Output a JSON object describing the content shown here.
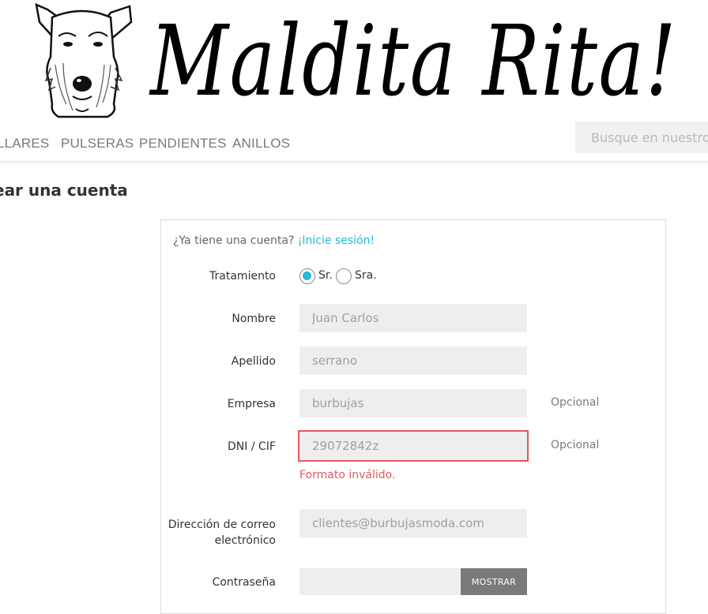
{
  "brand": {
    "name": "Maldita Rita!"
  },
  "nav": {
    "items": [
      "LLARES",
      "PULSERAS",
      "PENDIENTES",
      "ANILLOS"
    ],
    "search_placeholder": "Busque en nuestro"
  },
  "page": {
    "title": "ear una cuenta"
  },
  "form": {
    "login_prompt": "¿Ya tiene una cuenta?",
    "login_link": "¡Inicie sesión!",
    "title_label": "Tratamiento",
    "title_options": [
      {
        "label": "Sr.",
        "checked": true
      },
      {
        "label": "Sra.",
        "checked": false
      }
    ],
    "first_name_label": "Nombre",
    "first_name_value": "Juan Carlos",
    "last_name_label": "Apellido",
    "last_name_value": "serrano",
    "company_label": "Empresa",
    "company_value": "burbujas",
    "company_optional": "Opcional",
    "dni_label": "DNI / CIF",
    "dni_value": "29072842z",
    "dni_optional": "Opcional",
    "dni_error": "Formato inválido.",
    "email_label": "Dirección de correo electrónico",
    "email_value": "clientes@burbujasmoda.com",
    "password_label": "Contraseña",
    "password_value": "",
    "show_button": "MOSTRAR"
  },
  "colors": {
    "accent": "#25b9d7",
    "error": "#e25a5d",
    "input_bg": "#eeeeee",
    "nav_text": "#7a7a7a"
  },
  "icons": {
    "logo": "schnauzer-dog-icon"
  }
}
